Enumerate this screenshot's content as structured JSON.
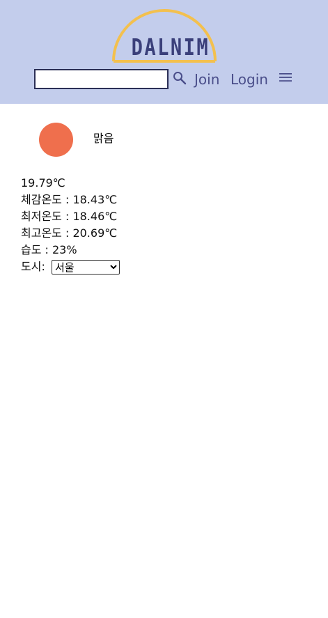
{
  "header": {
    "logo_text": "DALNIM",
    "logo_arc_color": "#f3c04e",
    "logo_text_color": "#3a3f7a",
    "background_color": "#c3cdec",
    "search": {
      "value": "",
      "placeholder": ""
    },
    "search_icon": "search-icon",
    "nav": {
      "join_label": "Join",
      "login_label": "Login"
    },
    "menu_icon": "hamburger-menu-icon"
  },
  "weather": {
    "icon_color": "#ef6f4d",
    "description": "맑음",
    "temperature": "19.79℃",
    "feels_like": "체감온도 : 18.43℃",
    "min_temp": "최저온도 : 18.46℃",
    "max_temp": "최고온도 : 20.69℃",
    "humidity": "습도 : 23%",
    "city_label": "도시:",
    "city_options": [
      "서울"
    ],
    "city_selected": "서울"
  }
}
